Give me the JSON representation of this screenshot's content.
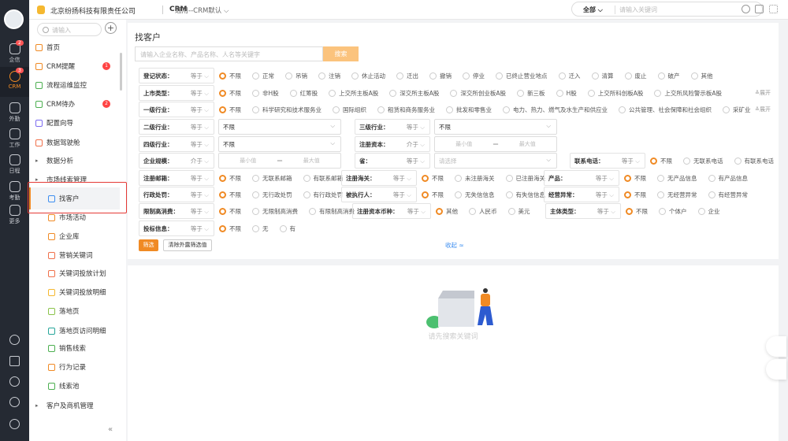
{
  "rail": {
    "items": [
      {
        "label": "企信",
        "badge": "2"
      },
      {
        "label": "CRM",
        "badge": "3"
      },
      {
        "label": "外勤"
      },
      {
        "label": "工作"
      },
      {
        "label": "日程"
      },
      {
        "label": "考勤"
      },
      {
        "label": "更多"
      }
    ]
  },
  "topbar": {
    "company": "北京纷扬科技有限责任公司",
    "app": "CRM",
    "template": "通用--CRM默认",
    "search_scope": "全部",
    "search_placeholder": "请输入关键词"
  },
  "sidebar": {
    "search_placeholder": "请输入",
    "items": [
      {
        "label": "首页",
        "color": "#f08a24"
      },
      {
        "label": "CRM提醒",
        "color": "#f08a24",
        "badge": "1"
      },
      {
        "label": "流程运维监控",
        "color": "#4caf50"
      },
      {
        "label": "CRM待办",
        "color": "#4caf50",
        "badge": "2"
      },
      {
        "label": "配置向导",
        "color": "#7c6cf0"
      },
      {
        "label": "数据驾驶舱",
        "color": "#f0704a"
      },
      {
        "label": "数据分析",
        "group": true
      },
      {
        "label": "市场线索管理",
        "group": true
      },
      {
        "label": "找客户",
        "sub": true,
        "color": "#3d8ef0"
      },
      {
        "label": "市场活动",
        "sub": true,
        "color": "#f08a24"
      },
      {
        "label": "企业库",
        "sub": true,
        "color": "#f08a24"
      },
      {
        "label": "营销关键词",
        "sub": true,
        "color": "#f0704a"
      },
      {
        "label": "关键词投放计划",
        "sub": true,
        "color": "#f0704a"
      },
      {
        "label": "关键词投放明细",
        "sub": true,
        "color": "#f5b830"
      },
      {
        "label": "落地页",
        "sub": true,
        "color": "#8bc34a"
      },
      {
        "label": "落地页访问明细",
        "sub": true,
        "color": "#26a69a"
      },
      {
        "label": "销售线索",
        "sub": true,
        "color": "#4caf50"
      },
      {
        "label": "行为记录",
        "sub": true,
        "color": "#f08a24"
      },
      {
        "label": "线索池",
        "sub": true,
        "color": "#4caf50"
      },
      {
        "label": "客户及商机管理",
        "group": true
      }
    ],
    "collapse": "«"
  },
  "main": {
    "title": "找客户",
    "keyword_placeholder": "请输入企业名称、产品名称、人名等关键字",
    "search_btn": "搜索",
    "expand": "≚展开",
    "filter_btn": "筛选",
    "clear_btn": "清除外露筛选值",
    "fold": "收起 ≈",
    "empty_text": "请先搜索关键词"
  },
  "filters": [
    [
      {
        "label": "登记状态：",
        "op": "等于",
        "type": "radio",
        "selected": 0,
        "options": [
          "不限",
          "正常",
          "吊销",
          "注销",
          "休止活动",
          "迁出",
          "撤销",
          "停业",
          "已终止营业地点",
          "迁入",
          "清算",
          "废止",
          "破产",
          "其他"
        ]
      }
    ],
    [
      {
        "label": "上市类型：",
        "op": "等于",
        "type": "radio",
        "selected": 0,
        "expand": true,
        "options": [
          "不限",
          "非H股",
          "红筹股",
          "上交所主板A股",
          "深交所主板A股",
          "深交所创业板A股",
          "新三板",
          "H股",
          "上交所科创板A股",
          "上交所风险警示板A股"
        ]
      }
    ],
    [
      {
        "label": "一级行业：",
        "op": "等于",
        "type": "radio",
        "selected": 0,
        "expand": true,
        "options": [
          "不限",
          "科学研究和技术服务业",
          "国际组织",
          "租赁和商务服务业",
          "批发和零售业",
          "电力、热力、燃气及水生产和供应业",
          "公共管理、社会保障和社会组织",
          "采矿业"
        ]
      }
    ],
    [
      {
        "label": "二级行业：",
        "op": "等于",
        "type": "select",
        "value": "不限"
      },
      {
        "label": "三级行业：",
        "op": "等于",
        "type": "select",
        "value": "不限"
      }
    ],
    [
      {
        "label": "四级行业：",
        "op": "等于",
        "type": "select",
        "value": "不限"
      },
      {
        "label": "注册资本：",
        "op": "介于",
        "type": "range",
        "min": "最小值",
        "max": "最大值"
      }
    ],
    [
      {
        "label": "企业规模：",
        "op": "介于",
        "type": "range",
        "min": "最小值",
        "max": "最大值"
      },
      {
        "label": "省：",
        "op": "等于",
        "type": "select",
        "placeholder": "请选择"
      },
      {
        "label": "联系电话：",
        "op": "等于",
        "type": "radio",
        "selected": 0,
        "options": [
          "不限",
          "无联系电话",
          "有联系电话"
        ]
      }
    ],
    [
      {
        "label": "注册邮箱：",
        "op": "等于",
        "type": "radio",
        "selected": 0,
        "options": [
          "不限",
          "无联系邮箱",
          "有联系邮箱"
        ]
      },
      {
        "label": "注册海关：",
        "op": "等于",
        "type": "radio",
        "selected": 0,
        "options": [
          "不限",
          "未注册海关",
          "已注册海关"
        ]
      },
      {
        "label": "产品：",
        "op": "等于",
        "type": "radio",
        "selected": 0,
        "options": [
          "不限",
          "无产品信息",
          "有产品信息"
        ]
      }
    ],
    [
      {
        "label": "行政处罚：",
        "op": "等于",
        "type": "radio",
        "selected": 0,
        "options": [
          "不限",
          "无行政处罚",
          "有行政处罚"
        ]
      },
      {
        "label": "被执行人：",
        "op": "等于",
        "type": "radio",
        "selected": 0,
        "options": [
          "不限",
          "无失信信息",
          "有失信信息"
        ]
      },
      {
        "label": "经营异常：",
        "op": "等于",
        "type": "radio",
        "selected": 0,
        "options": [
          "不限",
          "无经营异常",
          "有经营异常"
        ]
      }
    ],
    [
      {
        "label": "限制高消费：",
        "op": "等于",
        "type": "radio",
        "selected": 0,
        "options": [
          "不限",
          "无限制高消费",
          "有限制高消费"
        ]
      },
      {
        "label": "注册资本币种：",
        "op": "等于",
        "type": "radio",
        "selected": 0,
        "options": [
          "其他",
          "人民币",
          "美元"
        ]
      },
      {
        "label": "主体类型：",
        "op": "等于",
        "type": "radio",
        "selected": 0,
        "options": [
          "不限",
          "个体户",
          "企业"
        ]
      }
    ],
    [
      {
        "label": "投标信息：",
        "op": "等于",
        "type": "radio",
        "selected": 0,
        "options": [
          "不限",
          "无",
          "有"
        ]
      }
    ]
  ],
  "colors": {
    "accent": "#f08a24",
    "link": "#3d8ef0",
    "rail": "#252a33"
  }
}
